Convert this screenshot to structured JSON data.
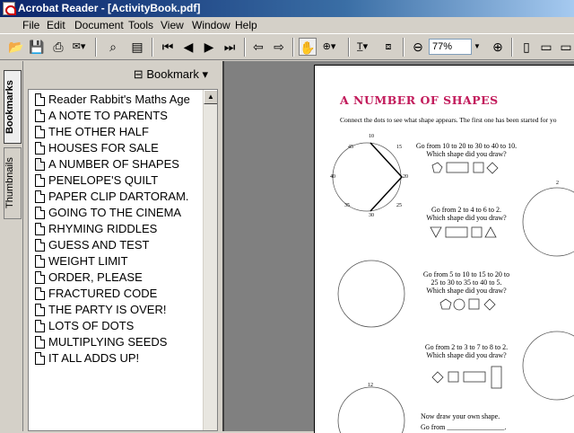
{
  "window": {
    "title": "Acrobat Reader - [ActivityBook.pdf]"
  },
  "menu": [
    "File",
    "Edit",
    "Document",
    "Tools",
    "View",
    "Window",
    "Help"
  ],
  "toolbar": {
    "zoom": "77%"
  },
  "panel": {
    "menu_label": "Bookmark",
    "tabs": [
      "Bookmarks",
      "Thumbnails"
    ],
    "bookmarks": [
      "Reader Rabbit's Maths Age",
      "A NOTE TO PARENTS",
      "THE OTHER HALF",
      "HOUSES FOR SALE",
      "A NUMBER OF SHAPES",
      "PENELOPE'S QUILT",
      "PAPER CLIP DARTORAM.",
      "GOING TO THE CINEMA",
      "RHYMING RIDDLES",
      "GUESS AND TEST",
      "WEIGHT LIMIT",
      "ORDER, PLEASE",
      "FRACTURED CODE",
      "THE PARTY IS OVER!",
      "LOTS OF DOTS",
      "MULTIPLYING SEEDS",
      "IT ALL ADDS UP!"
    ]
  },
  "document": {
    "title": "A NUMBER OF SHAPES",
    "instructions": "Connect the dots to see what shape appears. The first one has been started for yo",
    "questions": [
      {
        "line1": "Go from 10 to 20 to 30 to 40 to 10.",
        "line2": "Which shape did you draw?"
      },
      {
        "line1": "Go from 2 to 4 to 6 to 2.",
        "line2": "Which shape did you draw?"
      },
      {
        "line1": "Go from 5 to 10 to 15 to 20 to",
        "line1b": "25 to 30 to 35 to 40 to 5.",
        "line2": "Which shape did you draw?"
      },
      {
        "line1": "Go from 2 to 3 to 7 to 8 to 2.",
        "line2": "Which shape did you draw?"
      }
    ],
    "footer1": "Now draw your own shape.",
    "footer2": "Go from",
    "clock_labels": [
      "10",
      "20",
      "30",
      "40",
      "45",
      "35",
      "15",
      "25",
      "12",
      "2"
    ]
  }
}
